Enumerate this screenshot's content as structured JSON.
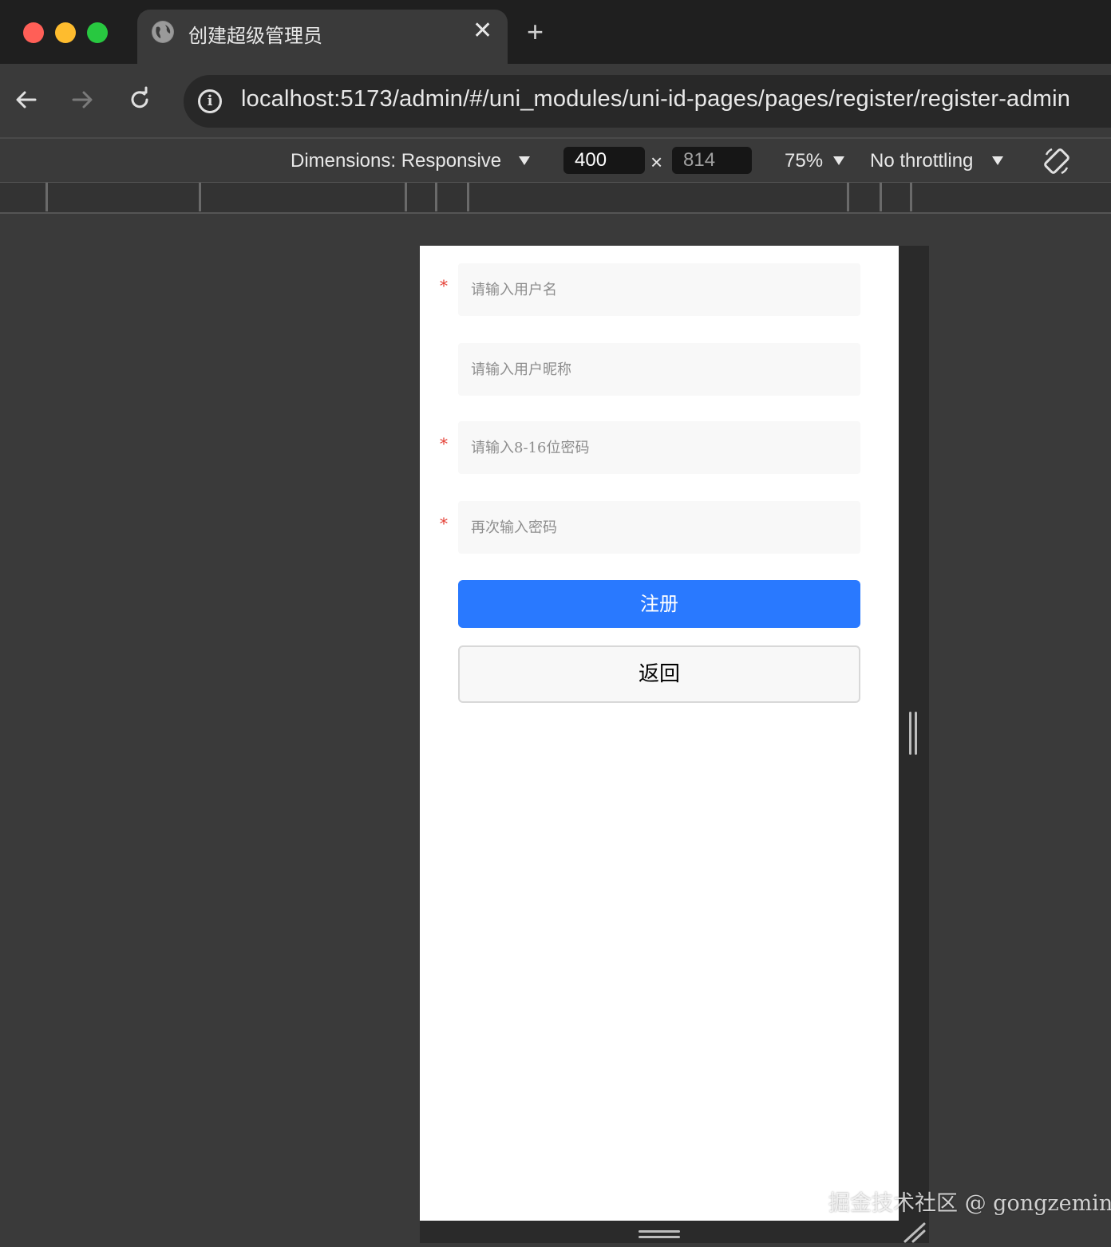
{
  "browser": {
    "tab": {
      "title": "创建超级管理员",
      "close_glyph": "✕"
    },
    "new_tab_glyph": "+",
    "url": "localhost:5173/admin/#/uni_modules/uni-id-pages/pages/register/register-admin",
    "info_glyph": "i"
  },
  "device_toolbar": {
    "dimensions_label": "Dimensions: Responsive",
    "width": "400",
    "height": "814",
    "times_glyph": "×",
    "zoom": "75%",
    "throttling": "No throttling"
  },
  "form": {
    "fields": [
      {
        "placeholder": "请输入用户名",
        "required": true
      },
      {
        "placeholder": "请输入用户昵称",
        "required": false
      },
      {
        "placeholder": "请输入8-16位密码",
        "required": true
      },
      {
        "placeholder": "再次输入密码",
        "required": true
      }
    ],
    "required_mark": "*",
    "register_label": "注册",
    "back_label": "返回"
  },
  "watermark": "掘金技术社区 @ gongzemin",
  "colors": {
    "primary": "#2979ff",
    "required": "#e43d33",
    "traffic_red": "#ff5f57",
    "traffic_yellow": "#febc2e",
    "traffic_green": "#28c840"
  }
}
